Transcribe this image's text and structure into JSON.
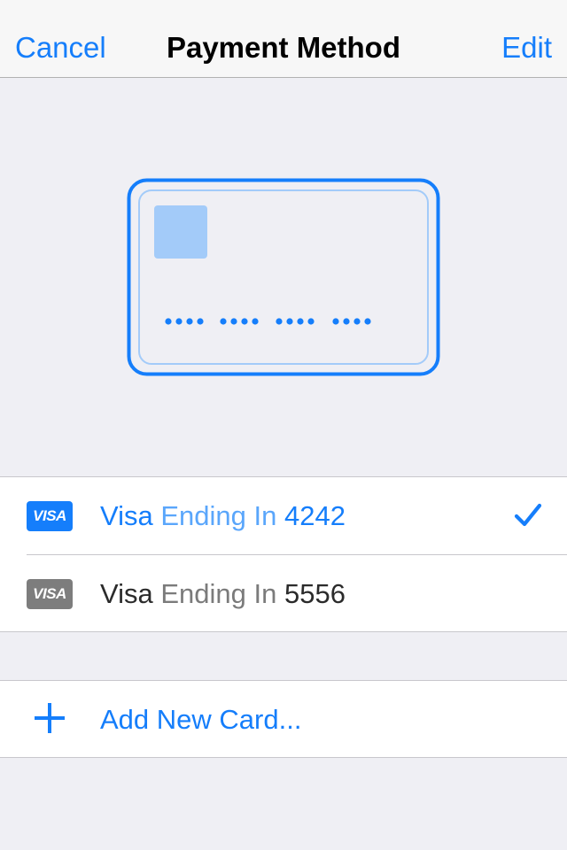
{
  "nav": {
    "cancel": "Cancel",
    "title": "Payment Method",
    "edit": "Edit"
  },
  "card_preview": {
    "number_mask": "•••• •••• •••• ••••",
    "accent_color": "#157efb",
    "light_color": "#a3cbf9",
    "icon": "credit-card-illustration"
  },
  "cards": [
    {
      "brand": "Visa",
      "badge": "VISA",
      "middle": "Ending In",
      "last4": "4242",
      "selected": true,
      "color": "#157efb",
      "middle_color": "#5aa6fb",
      "badge_color": "#157efb"
    },
    {
      "brand": "Visa",
      "badge": "VISA",
      "middle": "Ending In",
      "last4": "5556",
      "selected": false,
      "color": "#2b2b2b",
      "middle_color": "#7b7b7b",
      "badge_color": "#7d7d7d"
    }
  ],
  "add_card": {
    "label": "Add New Card...",
    "icon": "plus-icon"
  },
  "selected_icon": "checkmark-icon"
}
